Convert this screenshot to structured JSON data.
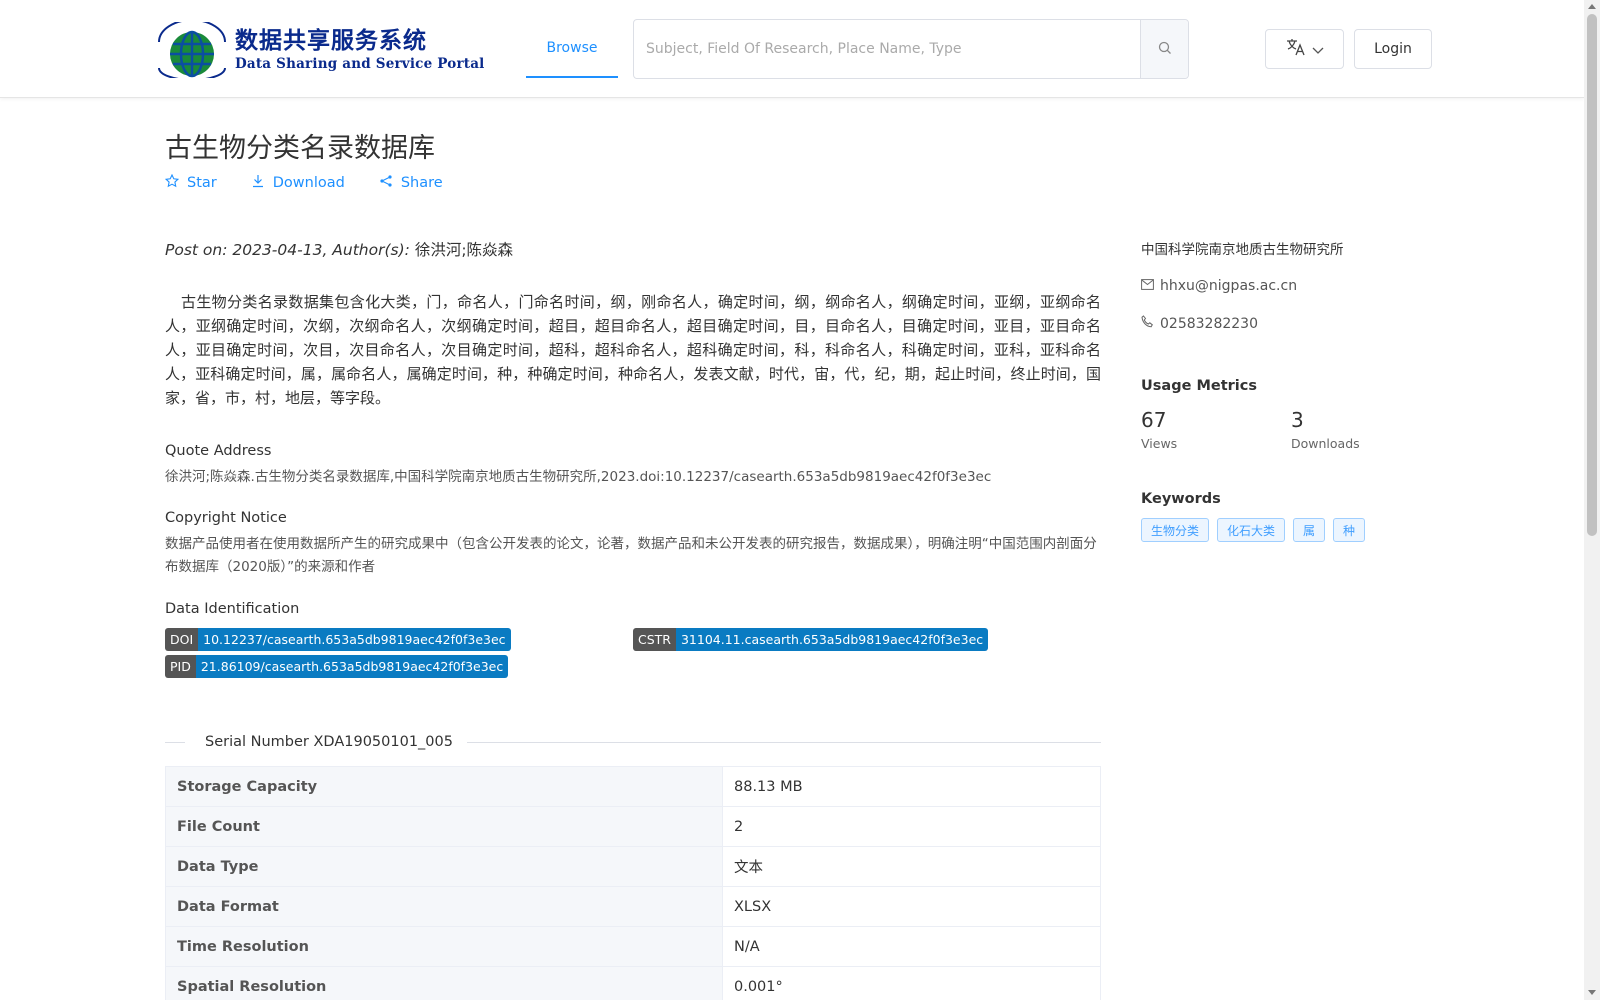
{
  "header": {
    "logo_cn": "数据共享服务系统",
    "logo_en": "Data Sharing and Service Portal",
    "nav_browse": "Browse",
    "search_placeholder": "Subject, Field Of Research, Place Name, Type",
    "login": "Login",
    "icons": {
      "search": "search-icon",
      "language": "translate-icon",
      "chevron": "chevron-down-icon"
    }
  },
  "dataset": {
    "title": "古生物分类名录数据库",
    "actions": {
      "star": "Star",
      "download": "Download",
      "share": "Share"
    },
    "post_on_prefix": "Post on: 2023-04-13, Author(s): ",
    "authors": "徐洪河;陈焱森",
    "description": "古生物分类名录数据集包含化大类，门，命名人，门命名时间，纲，刚命名人，确定时间，纲，纲命名人，纲确定时间，亚纲，亚纲命名人，亚纲确定时间，次纲，次纲命名人，次纲确定时间，超目，超目命名人，超目确定时间，目，目命名人，目确定时间，亚目，亚目命名人，亚目确定时间，次目，次目命名人，次目确定时间，超科，超科命名人，超科确定时间，科，科命名人，科确定时间，亚科，亚科命名人，亚科确定时间，属，属命名人，属确定时间，种，种确定时间，种命名人，发表文献，时代，宙，代，纪，期，起止时间，终止时间，国家，省，市，村，地层，等字段。",
    "quote_label": "Quote Address",
    "quote_text": "徐洪河;陈焱森.古生物分类名录数据库,中国科学院南京地质古生物研究所,2023.doi:10.12237/casearth.653a5db9819aec42f0f3e3ec",
    "copyright_label": "Copyright Notice",
    "copyright_text": "数据产品使用者在使用数据所产生的研究成果中（包含公开发表的论文，论著，数据产品和未公开发表的研究报告，数据成果），明确注明“中国范围内剖面分布数据库（2020版）”的来源和作者",
    "identification_label": "Data Identification",
    "identifiers": {
      "doi_key": "DOI",
      "doi_val": "10.12237/casearth.653a5db9819aec42f0f3e3ec",
      "cstr_key": "CSTR",
      "cstr_val": "31104.11.casearth.653a5db9819aec42f0f3e3ec",
      "pid_key": "PID",
      "pid_val": "21.86109/casearth.653a5db9819aec42f0f3e3ec"
    },
    "serial": "Serial Number XDA19050101_005",
    "table": [
      {
        "k": "Storage Capacity",
        "v": "88.13 MB"
      },
      {
        "k": "File Count",
        "v": "2"
      },
      {
        "k": "Data Type",
        "v": "文本"
      },
      {
        "k": "Data Format",
        "v": "XLSX"
      },
      {
        "k": "Time Resolution",
        "v": "N/A"
      },
      {
        "k": "Spatial Resolution",
        "v": "0.001°"
      }
    ]
  },
  "sidebar": {
    "org": "中国科学院南京地质古生物研究所",
    "email": "hhxu@nigpas.ac.cn",
    "phone": "02583282230",
    "metrics_title": "Usage Metrics",
    "views": "67",
    "views_label": "Views",
    "downloads": "3",
    "downloads_label": "Downloads",
    "keywords_title": "Keywords",
    "keywords": [
      "生物分类",
      "化石大类",
      "属",
      "种"
    ]
  },
  "colors": {
    "accent": "#1e90ff",
    "badge_key": "#555555",
    "badge_val": "#0a7bc2",
    "logo": "#0a2a8c"
  }
}
